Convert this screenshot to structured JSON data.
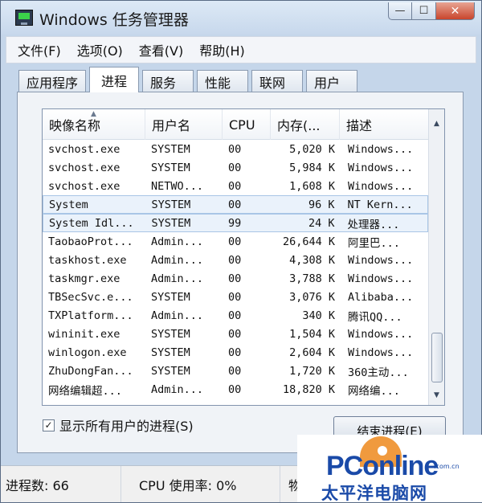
{
  "window": {
    "title": "Windows 任务管理器"
  },
  "menu": [
    "文件(F)",
    "选项(O)",
    "查看(V)",
    "帮助(H)"
  ],
  "tabs": [
    {
      "label": "应用程序",
      "active": false
    },
    {
      "label": "进程",
      "active": true
    },
    {
      "label": "服务",
      "active": false
    },
    {
      "label": "性能",
      "active": false
    },
    {
      "label": "联网",
      "active": false
    },
    {
      "label": "用户",
      "active": false
    }
  ],
  "process_table": {
    "columns": [
      "映像名称",
      "用户名",
      "CPU",
      "内存(...",
      "描述"
    ],
    "rows": [
      {
        "name": "svchost.exe",
        "user": "SYSTEM",
        "cpu": "00",
        "mem": "5,020 K",
        "desc": "Windows..."
      },
      {
        "name": "svchost.exe",
        "user": "SYSTEM",
        "cpu": "00",
        "mem": "5,984 K",
        "desc": "Windows..."
      },
      {
        "name": "svchost.exe",
        "user": "NETWO...",
        "cpu": "00",
        "mem": "1,608 K",
        "desc": "Windows..."
      },
      {
        "name": "System",
        "user": "SYSTEM",
        "cpu": "00",
        "mem": "96 K",
        "desc": "NT Kern..."
      },
      {
        "name": "System Idl...",
        "user": "SYSTEM",
        "cpu": "99",
        "mem": "24 K",
        "desc": "处理器..."
      },
      {
        "name": "TaobaoProt...",
        "user": "Admin...",
        "cpu": "00",
        "mem": "26,644 K",
        "desc": "阿里巴..."
      },
      {
        "name": "taskhost.exe",
        "user": "Admin...",
        "cpu": "00",
        "mem": "4,308 K",
        "desc": "Windows..."
      },
      {
        "name": "taskmgr.exe",
        "user": "Admin...",
        "cpu": "00",
        "mem": "3,788 K",
        "desc": "Windows..."
      },
      {
        "name": "TBSecSvc.e...",
        "user": "SYSTEM",
        "cpu": "00",
        "mem": "3,076 K",
        "desc": "Alibaba..."
      },
      {
        "name": "TXPlatform...",
        "user": "Admin...",
        "cpu": "00",
        "mem": "340 K",
        "desc": "腾讯QQ..."
      },
      {
        "name": "wininit.exe",
        "user": "SYSTEM",
        "cpu": "00",
        "mem": "1,504 K",
        "desc": "Windows..."
      },
      {
        "name": "winlogon.exe",
        "user": "SYSTEM",
        "cpu": "00",
        "mem": "2,604 K",
        "desc": "Windows..."
      },
      {
        "name": "ZhuDongFan...",
        "user": "SYSTEM",
        "cpu": "00",
        "mem": "1,720 K",
        "desc": "360主动..."
      },
      {
        "name": "网络编辑超...",
        "user": "Admin...",
        "cpu": "00",
        "mem": "18,820 K",
        "desc": "网络编..."
      }
    ]
  },
  "show_all_users": {
    "label": "显示所有用户的进程(S)",
    "checked": true
  },
  "end_process_button": "结束进程(E)",
  "status": {
    "process_count": "进程数: 66",
    "cpu_usage": "CPU 使用率: 0%",
    "memory": "物"
  },
  "watermark": {
    "brand": "PConline",
    "domain": ".com.cn",
    "cn": "太平洋电脑网"
  }
}
